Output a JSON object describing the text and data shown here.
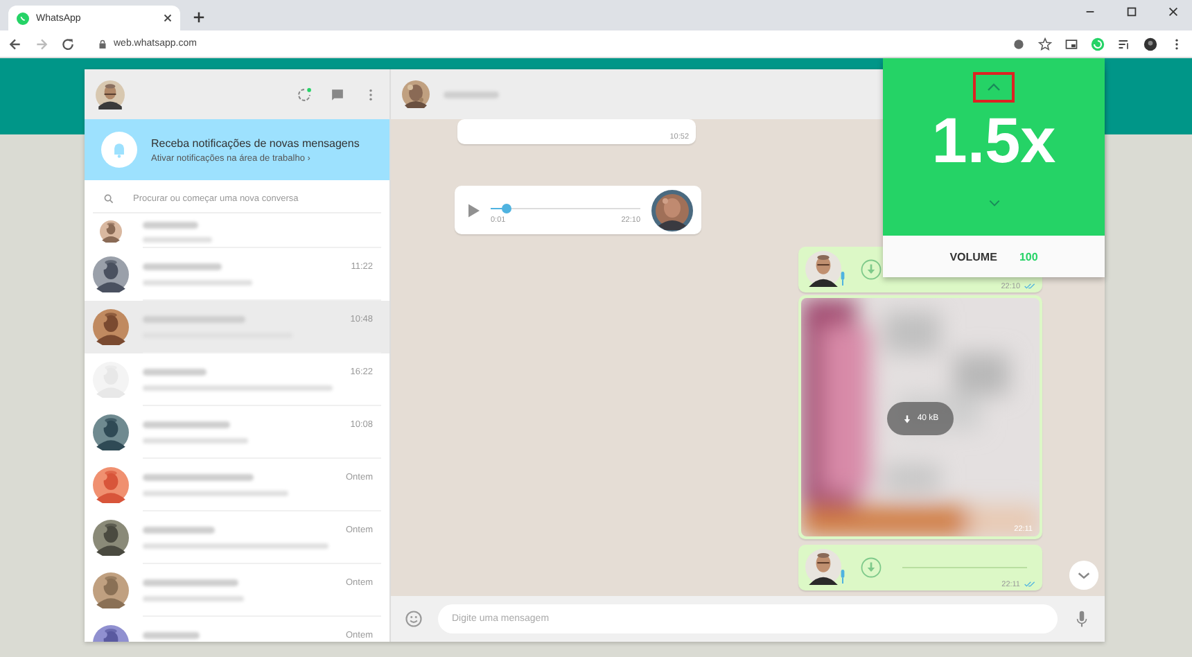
{
  "browser": {
    "tab": {
      "title": "WhatsApp"
    },
    "url": "web.whatsapp.com"
  },
  "sidebar": {
    "notification": {
      "title": "Receba notificações de novas mensagens",
      "link": "Ativar notificações na área de trabalho ›"
    },
    "search": {
      "placeholder": "Procurar ou começar uma nova conversa"
    },
    "chats": [
      {
        "selected": false
      },
      {
        "time": "11:22",
        "selected": false
      },
      {
        "time": "10:48",
        "selected": true
      },
      {
        "time": "16:22",
        "selected": false
      },
      {
        "time": "10:08",
        "selected": false
      },
      {
        "time": "Ontem",
        "selected": false
      },
      {
        "time": "Ontem",
        "selected": false
      },
      {
        "time": "Ontem",
        "selected": false
      },
      {
        "time": "Ontem",
        "selected": false
      }
    ]
  },
  "chat": {
    "messages": [
      {
        "kind": "text",
        "time": "10:52"
      },
      {
        "kind": "audio",
        "elapsed": "0:01",
        "time": "22:10",
        "level": 0.1
      },
      {
        "kind": "voice",
        "time": "22:10"
      },
      {
        "size": "40 kB",
        "time": "22:11"
      },
      {
        "kind": "voice",
        "time": "22:11"
      }
    ],
    "composer": {
      "placeholder": "Digite uma mensagem"
    }
  },
  "speed_popup": {
    "speed": "1.5x",
    "volume_label": "VOLUME",
    "volume": "100"
  }
}
